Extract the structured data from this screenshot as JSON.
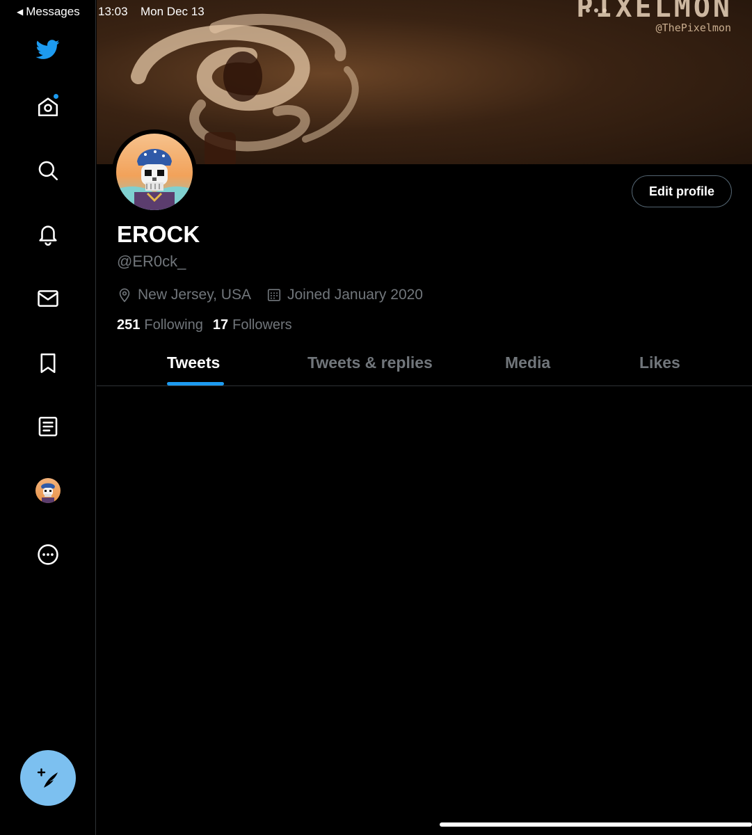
{
  "status_bar": {
    "back_label": "Messages",
    "time": "13:03",
    "date": "Mon Dec 13"
  },
  "sidebar": {
    "items": [
      {
        "name": "twitter-logo",
        "icon": "bird-icon"
      },
      {
        "name": "home",
        "icon": "home-icon",
        "has_dot": true
      },
      {
        "name": "explore",
        "icon": "search-icon"
      },
      {
        "name": "notifications",
        "icon": "bell-icon"
      },
      {
        "name": "messages",
        "icon": "mail-icon"
      },
      {
        "name": "bookmarks",
        "icon": "bookmark-icon"
      },
      {
        "name": "lists",
        "icon": "list-icon"
      },
      {
        "name": "profile",
        "icon": "avatar"
      },
      {
        "name": "more",
        "icon": "more-icon"
      }
    ],
    "compose_icon": "compose-tweet-icon"
  },
  "banner": {
    "brand": "PIXELMON",
    "handle": "@ThePixelmon"
  },
  "profile": {
    "display_name": "EROCK",
    "username": "@ER0ck_",
    "location": "New Jersey, USA",
    "joined": "Joined January 2020",
    "following_count": "251",
    "following_label": "Following",
    "followers_count": "17",
    "followers_label": "Followers",
    "edit_label": "Edit profile"
  },
  "tabs": [
    {
      "label": "Tweets",
      "active": true
    },
    {
      "label": "Tweets & replies",
      "active": false
    },
    {
      "label": "Media",
      "active": false
    },
    {
      "label": "Likes",
      "active": false
    }
  ],
  "colors": {
    "accent": "#1d9bf0",
    "compose_button": "#7cc0f0",
    "muted_text": "#71767b",
    "background": "#000000"
  }
}
